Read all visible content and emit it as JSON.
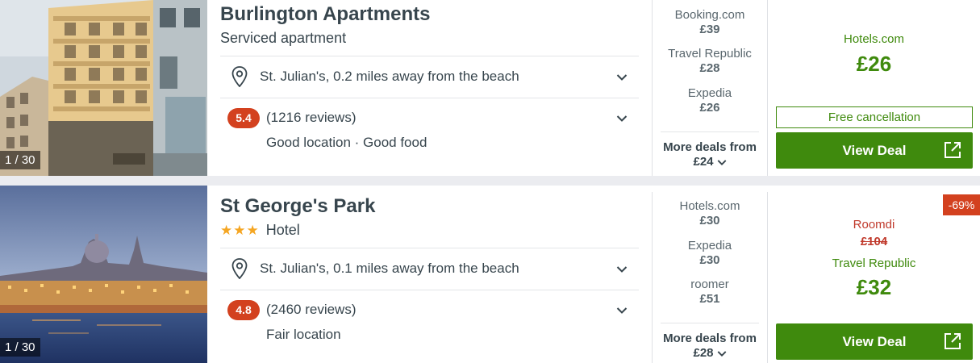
{
  "listings": [
    {
      "photo_counter": "1 / 30",
      "name": "Burlington Apartments",
      "type": "Serviced apartment",
      "stars": "",
      "location": "St. Julian's, 0.2 miles away from the beach",
      "rating": "5.4",
      "reviews": "(1216 reviews)",
      "highlights": "Good location · Good food",
      "deals": [
        {
          "provider": "Booking.com",
          "price": "£39"
        },
        {
          "provider": "Travel Republic",
          "price": "£28"
        },
        {
          "provider": "Expedia",
          "price": "£26"
        }
      ],
      "more_deals_label": "More deals from",
      "more_deals_price": "£24",
      "main_provider": "Hotels.com",
      "main_price": "£26",
      "free_cancellation": "Free cancellation",
      "view_deal": "View Deal"
    },
    {
      "photo_counter": "1 / 30",
      "name": "St George's Park",
      "type": "Hotel",
      "stars": "★★★",
      "location": "St. Julian's, 0.1 miles away from the beach",
      "rating": "4.8",
      "reviews": "(2460 reviews)",
      "highlights": "Fair location",
      "deals": [
        {
          "provider": "Hotels.com",
          "price": "£30"
        },
        {
          "provider": "Expedia",
          "price": "£30"
        },
        {
          "provider": "roomer",
          "price": "£51"
        }
      ],
      "more_deals_label": "More deals from",
      "more_deals_price": "£28",
      "discount": "-69%",
      "old_provider": "Roomdi",
      "old_price": "£104",
      "main_provider": "Travel Republic",
      "main_price": "£32",
      "view_deal": "View Deal"
    }
  ],
  "icons": {
    "pin": "location-pin-icon",
    "chevron": "chevron-down-icon",
    "external": "external-link-icon"
  },
  "colors": {
    "deal_green": "#3f8a0d",
    "rating_red": "#d3411f",
    "star_orange": "#f5a623"
  }
}
